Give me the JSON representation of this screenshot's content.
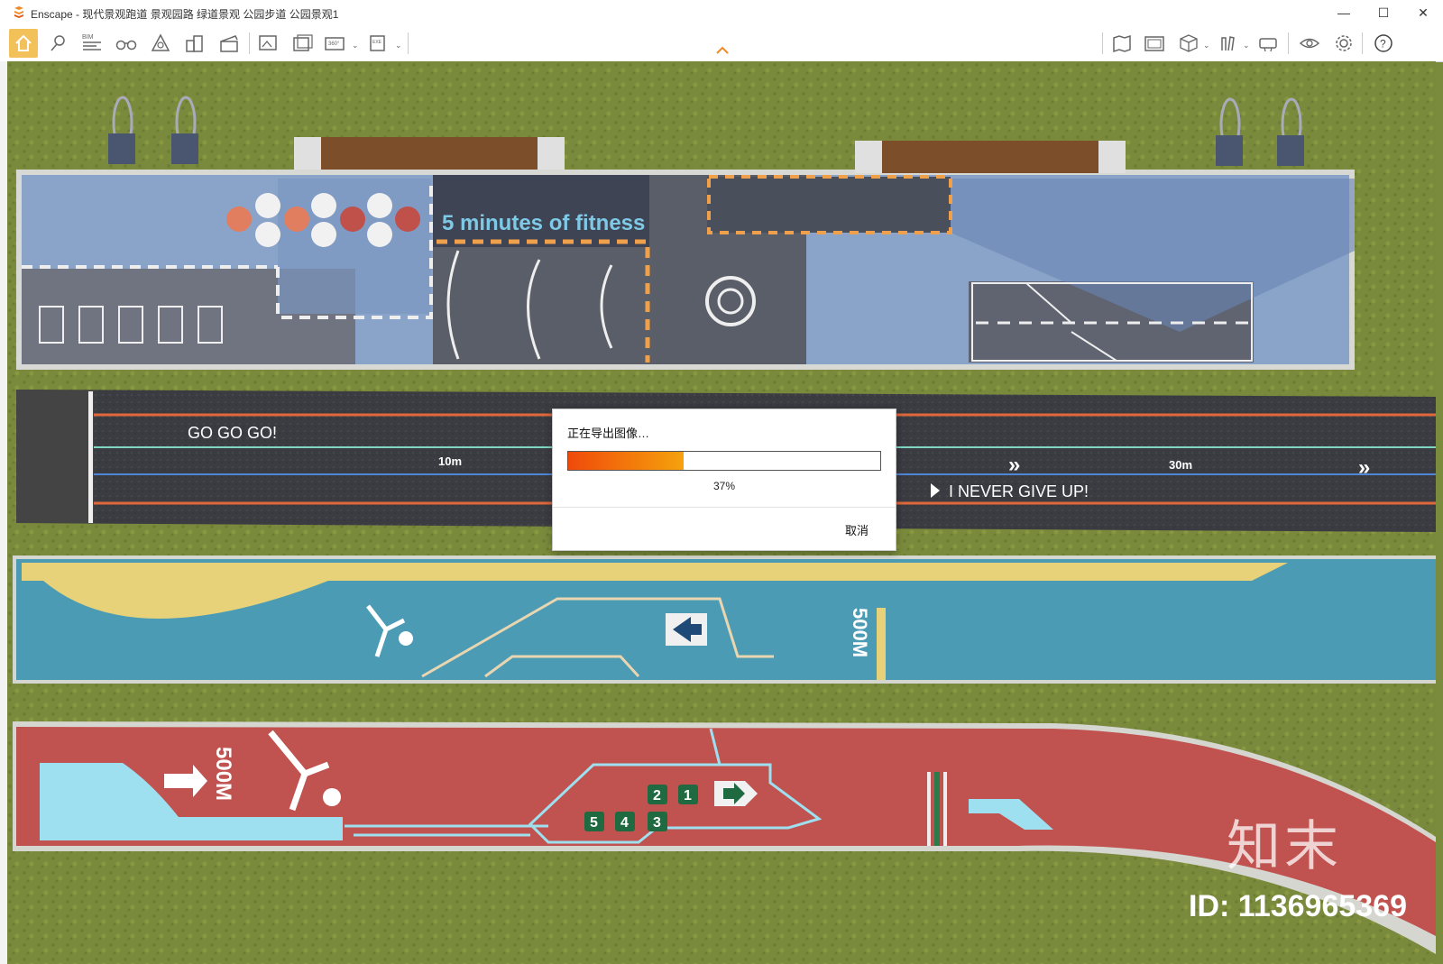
{
  "window": {
    "title": "Enscape - 现代景观跑道 景观园路 绿道景观 公园步道 公园景观1",
    "controls": {
      "minimize": "—",
      "maximize": "☐",
      "close": "✕"
    }
  },
  "toolbar": {
    "bim_label": "BIM",
    "icons_left": [
      "home-icon",
      "pin-icon",
      "bim-icon",
      "binoculars-icon",
      "hierarchy-icon",
      "buildings-icon",
      "clapper-icon",
      "export-image-icon",
      "batch-export-icon",
      "panorama-export-icon",
      "exe-export-icon"
    ],
    "icons_right": [
      "map-icon",
      "media-icon",
      "cube-icon",
      "asset-library-icon",
      "vr-headset-icon",
      "eye-icon",
      "gear-icon",
      "help-icon"
    ]
  },
  "scene": {
    "fitness_title": "5 minutes of fitness",
    "go_text": "GO GO GO!",
    "label_10m": "10m",
    "label_30m": "30m",
    "never_text": "I NEVER  GIVE UP!",
    "label_500m_blue": "500M",
    "label_500m_red": "500M",
    "lane_numbers": [
      "1",
      "2",
      "3",
      "4",
      "5"
    ]
  },
  "dialog": {
    "title": "正在导出图像…",
    "progress": 0.37,
    "percent_label": "37%",
    "cancel_label": "取消"
  },
  "watermark": {
    "logo_text": "知末",
    "id_text": "ID: 1136965369"
  },
  "colors": {
    "grass": "#7a8a3c",
    "court_blue": "#8aa3c9",
    "asphalt": "#3a3a40",
    "track_teal": "#4b9bb5",
    "track_red": "#c0524f",
    "accent_orange": "#f08a28",
    "toolbar_home": "#f3c15a"
  }
}
